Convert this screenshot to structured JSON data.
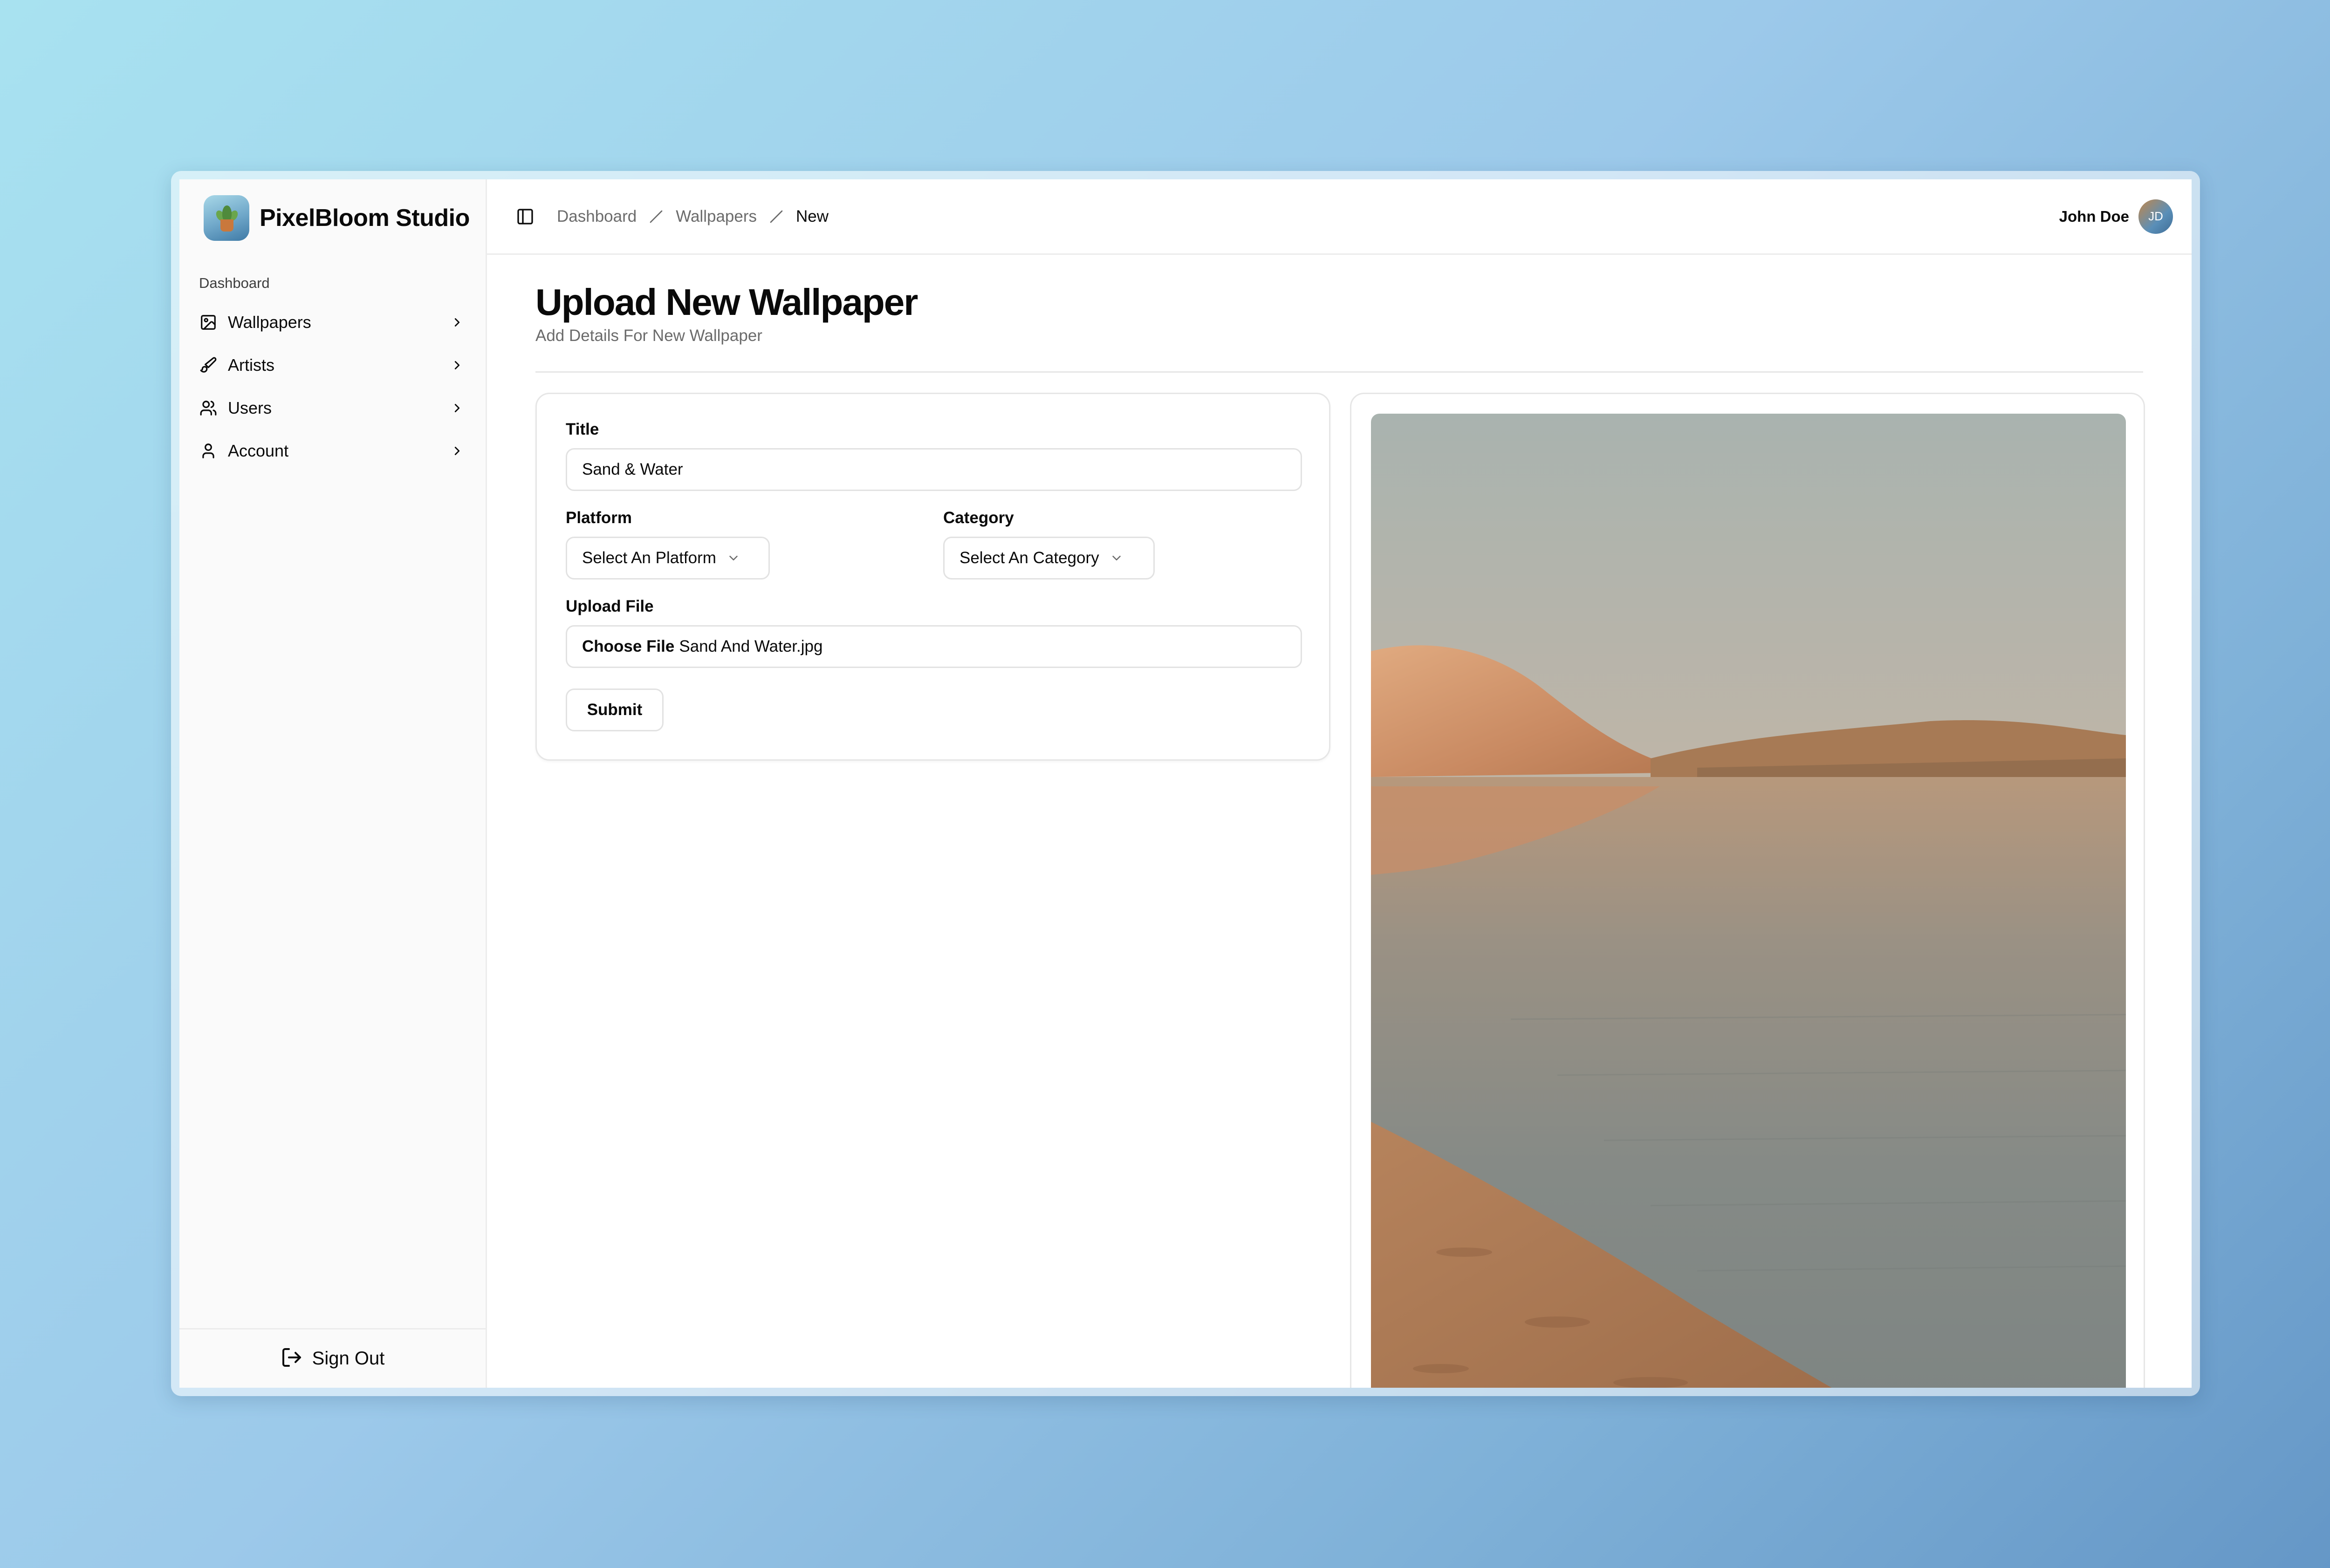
{
  "brand": {
    "name": "PixelBloom Studio",
    "logo_icon": "potted-plant-icon"
  },
  "sidebar": {
    "group_label": "Dashboard",
    "items": [
      {
        "label": "Wallpapers",
        "icon": "image-icon"
      },
      {
        "label": "Artists",
        "icon": "brush-icon"
      },
      {
        "label": "Users",
        "icon": "users-icon"
      },
      {
        "label": "Account",
        "icon": "user-icon"
      }
    ],
    "signout_label": "Sign Out"
  },
  "topbar": {
    "breadcrumb": [
      "Dashboard",
      "Wallpapers",
      "New"
    ],
    "user_name": "John Doe",
    "user_initials": "JD"
  },
  "page": {
    "title": "Upload New Wallpaper",
    "subtitle": "Add Details For New Wallpaper"
  },
  "form": {
    "title_label": "Title",
    "title_value": "Sand & Water",
    "platform_label": "Platform",
    "platform_value": "Select An Platform",
    "category_label": "Category",
    "category_value": "Select An Category",
    "upload_label": "Upload File",
    "file_button": "Choose File",
    "file_name": "Sand And Water.jpg",
    "submit_label": "Submit"
  },
  "colors": {
    "accent": "#0a0a0a",
    "muted_text": "#6b6b6b",
    "border": "#e2e2e2",
    "sidebar_bg": "#fafafa"
  }
}
